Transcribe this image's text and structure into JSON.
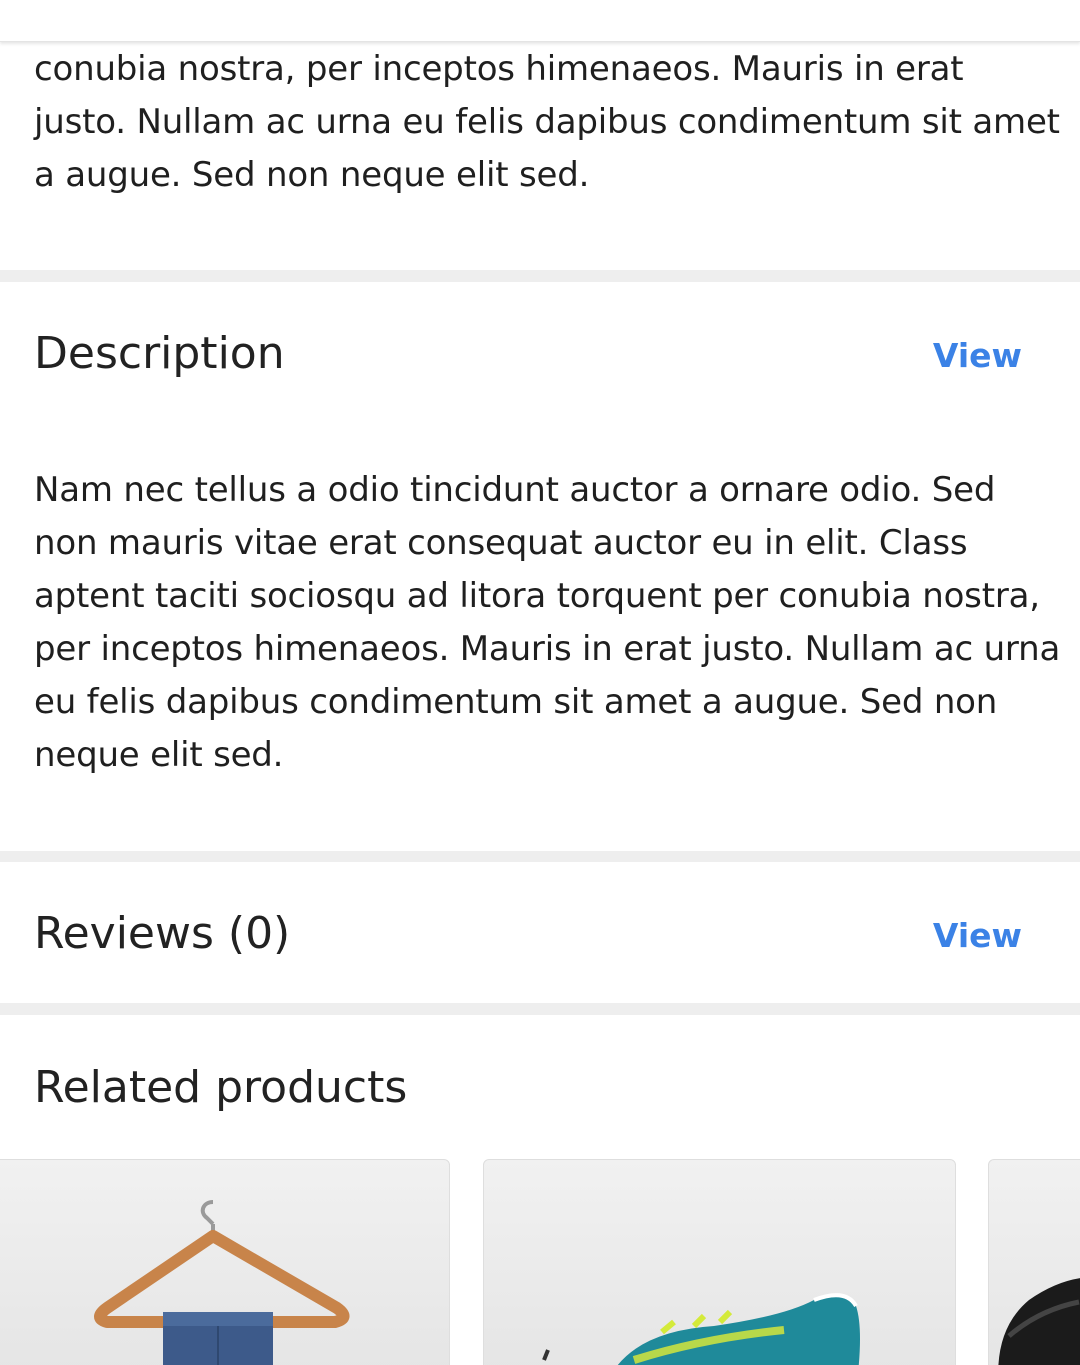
{
  "top_text": "conubia nostra, per inceptos himenaeos. Mauris in erat justo. Nullam ac urna eu felis dapibus condimentum sit amet a augue. Sed non neque elit sed.",
  "description": {
    "title": "Description",
    "view_label": "View",
    "body": "Nam nec tellus a odio tincidunt auctor a ornare odio. Sed non mauris vitae erat consequat auctor eu in elit. Class aptent taciti sociosqu ad litora torquent per conubia nostra, per inceptos himenaeos. Mauris in erat justo. Nullam ac urna eu felis dapibus condimentum sit amet a augue. Sed non neque elit sed."
  },
  "reviews": {
    "title": "Reviews (0)",
    "view_label": "View"
  },
  "related": {
    "title": "Related products",
    "products": [
      {
        "image": "jeans-on-hanger"
      },
      {
        "image": "teal-running-shoe"
      },
      {
        "image": "black-shoe"
      }
    ]
  },
  "colors": {
    "link": "#3b82e6",
    "divider": "#eeeeee",
    "text": "#1f1f1f"
  }
}
